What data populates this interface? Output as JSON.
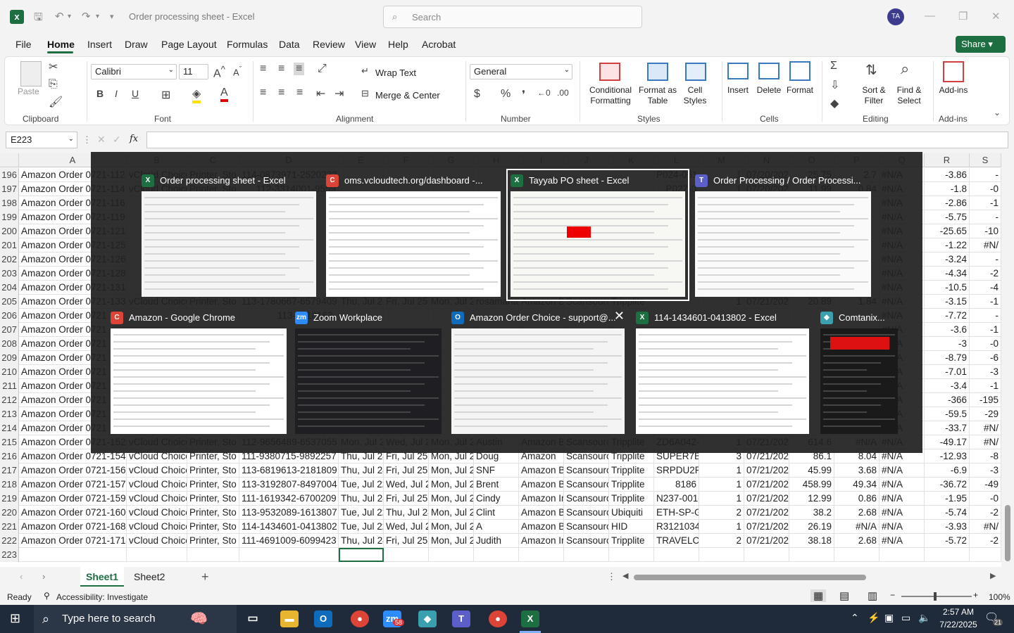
{
  "titlebar": {
    "doc_title": "Order processing sheet  -  Excel",
    "search_placeholder": "Search",
    "avatar_initials": "TA",
    "share_label": "Share"
  },
  "menu": [
    "File",
    "Home",
    "Insert",
    "Draw",
    "Page Layout",
    "Formulas",
    "Data",
    "Review",
    "View",
    "Help",
    "Acrobat"
  ],
  "ribbon": {
    "groups": [
      "Clipboard",
      "Font",
      "Alignment",
      "Number",
      "Styles",
      "Cells",
      "Editing",
      "Add-ins"
    ],
    "paste": "Paste",
    "font_name": "Calibri",
    "font_size": "11",
    "wrap_text": "Wrap Text",
    "merge_center": "Merge & Center",
    "number_format": "General",
    "conditional_formatting": "Conditional Formatting",
    "format_as_table": "Format as Table",
    "cell_styles": "Cell Styles",
    "insert": "Insert",
    "delete": "Delete",
    "format": "Format",
    "sort_filter": "Sort & Filter",
    "find_select": "Find & Select",
    "addins": "Add-ins"
  },
  "formula_bar": {
    "name_box": "E223",
    "fx": "fx",
    "value": ""
  },
  "columns": [
    "A",
    "B",
    "C",
    "D",
    "E",
    "F",
    "G",
    "H",
    "I",
    "J",
    "K",
    "L",
    "M",
    "N",
    "O",
    "P",
    "Q",
    "R",
    "S"
  ],
  "rows": [
    {
      "n": "196",
      "cells": [
        "Amazon Order 0721-112",
        "vCloud Choice",
        "Printer, Sto",
        "114-0873971-2520232",
        "",
        "",
        "",
        "",
        "",
        "",
        "",
        "P024-0514",
        "1",
        "07/20/202",
        "25.75",
        "2.7",
        "#N/A",
        "-3.86",
        "-"
      ]
    },
    {
      "n": "197",
      "cells": [
        "Amazon Order 0721-114",
        "vCloud Choice",
        "Printer, Sto",
        "112-3314001-9559",
        "",
        "",
        "",
        "",
        "",
        "",
        "",
        "P027-0",
        "1",
        "07/20/202",
        "11.99",
        "0.84",
        "#N/A",
        "-1.8",
        "-0"
      ]
    },
    {
      "n": "198",
      "cells": [
        "Amazon Order 0721-116",
        "",
        "",
        "",
        "",
        "",
        "",
        "",
        "",
        "",
        "",
        "",
        "",
        "",
        "",
        "",
        "#N/A",
        "-2.86",
        "-1"
      ]
    },
    {
      "n": "199",
      "cells": [
        "Amazon Order 0721-119",
        "",
        "",
        "",
        "",
        "",
        "",
        "",
        "",
        "",
        "",
        "",
        "",
        "",
        "",
        "",
        "#N/A",
        "-5.75",
        "-"
      ]
    },
    {
      "n": "200",
      "cells": [
        "Amazon Order 0721-121",
        "",
        "",
        "",
        "",
        "",
        "",
        "",
        "",
        "",
        "",
        "",
        "",
        "",
        "",
        "",
        "#N/A",
        "-25.65",
        "-10"
      ]
    },
    {
      "n": "201",
      "cells": [
        "Amazon Order 0721-125",
        "",
        "",
        "",
        "",
        "",
        "",
        "",
        "",
        "",
        "",
        "",
        "",
        "",
        "",
        "",
        "#N/A",
        "-1.22",
        "#N/"
      ]
    },
    {
      "n": "202",
      "cells": [
        "Amazon Order 0721-126",
        "",
        "",
        "",
        "",
        "",
        "",
        "",
        "",
        "",
        "",
        "",
        "",
        "",
        "",
        "",
        "#N/A",
        "-3.24",
        "-"
      ]
    },
    {
      "n": "203",
      "cells": [
        "Amazon Order 0721-128",
        "",
        "",
        "",
        "",
        "",
        "",
        "",
        "",
        "",
        "",
        "",
        "",
        "",
        "",
        "",
        "#N/A",
        "-4.34",
        "-2"
      ]
    },
    {
      "n": "204",
      "cells": [
        "Amazon Order 0721-131",
        "",
        "",
        "",
        "",
        "",
        "",
        "",
        "",
        "",
        "",
        "",
        "",
        "",
        "",
        "",
        "#N/A",
        "-10.5",
        "-4"
      ]
    },
    {
      "n": "205",
      "cells": [
        "Amazon Order 0721-133",
        "vCloud Choice",
        "Printer, Sto",
        "113-1780667-6579409",
        "Thu, Jul 24",
        "Fri, Jul 25,",
        "Mon, Jul 2",
        "rosamaria",
        "Amazon B",
        "Scansourc",
        "Tripplite",
        "",
        "1",
        "07/21/202",
        "20.89",
        "1.84",
        "#N/A",
        "-3.15",
        "-1"
      ]
    },
    {
      "n": "206",
      "cells": [
        "Amazon Order 0721",
        "",
        "",
        "113-2418163-",
        "",
        "",
        "",
        "",
        "",
        "",
        "",
        "",
        "",
        "",
        "",
        "",
        "#N/A",
        "-7.72",
        "-"
      ]
    },
    {
      "n": "207",
      "cells": [
        "Amazon Order 0721",
        "",
        "",
        "",
        "",
        "",
        "",
        "",
        "",
        "",
        "",
        "",
        "",
        "",
        "",
        "",
        "#N/A",
        "-3.6",
        "-1"
      ]
    },
    {
      "n": "208",
      "cells": [
        "Amazon Order 0721",
        "",
        "",
        "",
        "",
        "",
        "",
        "",
        "",
        "",
        "",
        "",
        "",
        "",
        "",
        "",
        "#N/A",
        "-3",
        "-0"
      ]
    },
    {
      "n": "209",
      "cells": [
        "Amazon Order 0721",
        "",
        "",
        "",
        "",
        "",
        "",
        "",
        "",
        "",
        "",
        "",
        "",
        "",
        "",
        "",
        "#N/A",
        "-8.79",
        "-6"
      ]
    },
    {
      "n": "210",
      "cells": [
        "Amazon Order 0721",
        "",
        "",
        "",
        "",
        "",
        "",
        "",
        "",
        "",
        "",
        "",
        "",
        "",
        "",
        "",
        "#N/A",
        "-7.01",
        "-3"
      ]
    },
    {
      "n": "211",
      "cells": [
        "Amazon Order 0721",
        "",
        "",
        "",
        "",
        "",
        "",
        "",
        "",
        "",
        "",
        "",
        "",
        "",
        "",
        "",
        "#N/A",
        "-3.4",
        "-1"
      ]
    },
    {
      "n": "212",
      "cells": [
        "Amazon Order 0721",
        "",
        "",
        "",
        "",
        "",
        "",
        "",
        "",
        "",
        "",
        "",
        "",
        "",
        "",
        "",
        "#N/A",
        "-366",
        "-195"
      ]
    },
    {
      "n": "213",
      "cells": [
        "Amazon Order 0721",
        "",
        "",
        "",
        "",
        "",
        "",
        "",
        "",
        "",
        "",
        "",
        "",
        "",
        "",
        "",
        "#N/A",
        "-59.5",
        "-29"
      ]
    },
    {
      "n": "214",
      "cells": [
        "Amazon Order 0721",
        "",
        "",
        "",
        "",
        "",
        "",
        "",
        "",
        "",
        "",
        "",
        "",
        "",
        "",
        "",
        "#N/A",
        "-33.7",
        "#N/"
      ]
    },
    {
      "n": "215",
      "cells": [
        "Amazon Order 0721-152",
        "vCloud Choice",
        "Printer, Sto",
        "112-9656489-6537055",
        "Mon, Jul 2",
        "Wed, Jul 2",
        "Mon, Jul 2",
        "Austin",
        "Amazon B",
        "Scansourc",
        "Tripplite",
        "ZD6A042-",
        "1",
        "07/21/202",
        "614.6",
        "#N/A",
        "#N/A",
        "-49.17",
        "#N/"
      ]
    },
    {
      "n": "216",
      "cells": [
        "Amazon Order 0721-154",
        "vCloud Choice",
        "Printer, Sto",
        "111-9380715-9892257",
        "Thu, Jul 24",
        "Fri, Jul 25,",
        "Mon, Jul 2",
        "Doug",
        "Amazon",
        "Scansourc",
        "Tripplite",
        "SUPER7B",
        "3",
        "07/21/202",
        "86.1",
        "8.04",
        "#N/A",
        "-12.93",
        "-8"
      ]
    },
    {
      "n": "217",
      "cells": [
        "Amazon Order 0721-156",
        "vCloud Choice",
        "Printer, Sto",
        "113-6819613-2181809",
        "Thu, Jul 24",
        "Fri, Jul 25,",
        "Mon, Jul 2",
        "SNF",
        "Amazon B",
        "Scansourc",
        "Tripplite",
        "SRPDU2PE",
        "1",
        "07/21/202",
        "45.99",
        "3.68",
        "#N/A",
        "-6.9",
        "-3"
      ]
    },
    {
      "n": "218",
      "cells": [
        "Amazon Order 0721-157",
        "vCloud Choice",
        "Printer, Sto",
        "113-3192807-8497004",
        "Tue, Jul 22",
        "Wed, Jul 2",
        "Mon, Jul 2",
        "Brent",
        "Amazon B",
        "Scansourc",
        "Tripplite",
        "8186",
        "1",
        "07/21/202",
        "458.99",
        "49.34",
        "#N/A",
        "-36.72",
        "-49"
      ]
    },
    {
      "n": "219",
      "cells": [
        "Amazon Order 0721-159",
        "vCloud Choice",
        "Printer, Sto",
        "111-1619342-6700209",
        "Thu, Jul 24",
        "Fri, Jul 25,",
        "Mon, Jul 2",
        "Cindy",
        "Amazon Ir",
        "Scansourc",
        "Tripplite",
        "N237-001-",
        "1",
        "07/21/202",
        "12.99",
        "0.86",
        "#N/A",
        "-1.95",
        "-0"
      ]
    },
    {
      "n": "220",
      "cells": [
        "Amazon Order 0721-160",
        "vCloud Choice",
        "Printer, Sto",
        "113-9532089-1613807",
        "Tue, Jul 22",
        "Thu, Jul 24",
        "Mon, Jul 2",
        "Clint",
        "Amazon B",
        "Scansourc",
        "Ubiquiti",
        "ETH-SP-G2",
        "2",
        "07/21/202",
        "38.2",
        "2.68",
        "#N/A",
        "-5.74",
        "-2"
      ]
    },
    {
      "n": "221",
      "cells": [
        "Amazon Order 0721-168",
        "vCloud Choice",
        "Printer, Sto",
        "114-1434601-0413802",
        "Tue, Jul 22",
        "Wed, Jul 2",
        "Mon, Jul 2",
        "A",
        "Amazon B",
        "Scansourc",
        "HID",
        "R31210349",
        "1",
        "07/21/202",
        "26.19",
        "#N/A",
        "#N/A",
        "-3.93",
        "#N/"
      ]
    },
    {
      "n": "222",
      "cells": [
        "Amazon Order 0721-171",
        "vCloud Choice",
        "Printer, Sto",
        "111-4691009-6099423",
        "Thu, Jul 24",
        "Fri, Jul 25,",
        "Mon, Jul 2",
        "Judith",
        "Amazon Ir",
        "Scansourc",
        "Tripplite",
        "TRAVELCU",
        "2",
        "07/21/202",
        "38.18",
        "2.68",
        "#N/A",
        "-5.72",
        "-2"
      ]
    },
    {
      "n": "223",
      "cells": [
        "",
        "",
        "",
        "",
        "",
        "",
        "",
        "",
        "",
        "",
        "",
        "",
        "",
        "",
        "",
        "",
        "",
        "",
        ""
      ]
    }
  ],
  "sheets": [
    "Sheet1",
    "Sheet2"
  ],
  "status": {
    "ready": "Ready",
    "accessibility": "Accessibility: Investigate",
    "zoom": "100%"
  },
  "taskbar": {
    "search_placeholder": "Type here to search",
    "time": "2:57 AM",
    "date": "7/22/2025",
    "notif_count": "21",
    "zoom_badge": "58"
  },
  "switcher": [
    {
      "title": "Order processing sheet - Excel",
      "app": "X",
      "color": "#1d6f42"
    },
    {
      "title": "oms.vcloudtech.org/dashboard -...",
      "app": "C",
      "color": "#db4437"
    },
    {
      "title": "Tayyab PO sheet - Excel",
      "app": "X",
      "color": "#1d6f42"
    },
    {
      "title": "Order Processing / Order Processi...",
      "app": "T",
      "color": "#5b5fc7"
    },
    {
      "title": "Amazon - Google Chrome",
      "app": "C",
      "color": "#db4437"
    },
    {
      "title": "Zoom Workplace",
      "app": "zm",
      "color": "#2d8cff"
    },
    {
      "title": "Amazon Order Choice - support@...",
      "app": "O",
      "color": "#0f6cbd"
    },
    {
      "title": "114-1434601-0413802 - Excel",
      "app": "X",
      "color": "#1d6f42"
    },
    {
      "title": "Comtanix...",
      "app": "◆",
      "color": "#3aa0b0"
    }
  ],
  "colors": {
    "excel_green": "#1d6f42",
    "overlay": "#202020"
  }
}
